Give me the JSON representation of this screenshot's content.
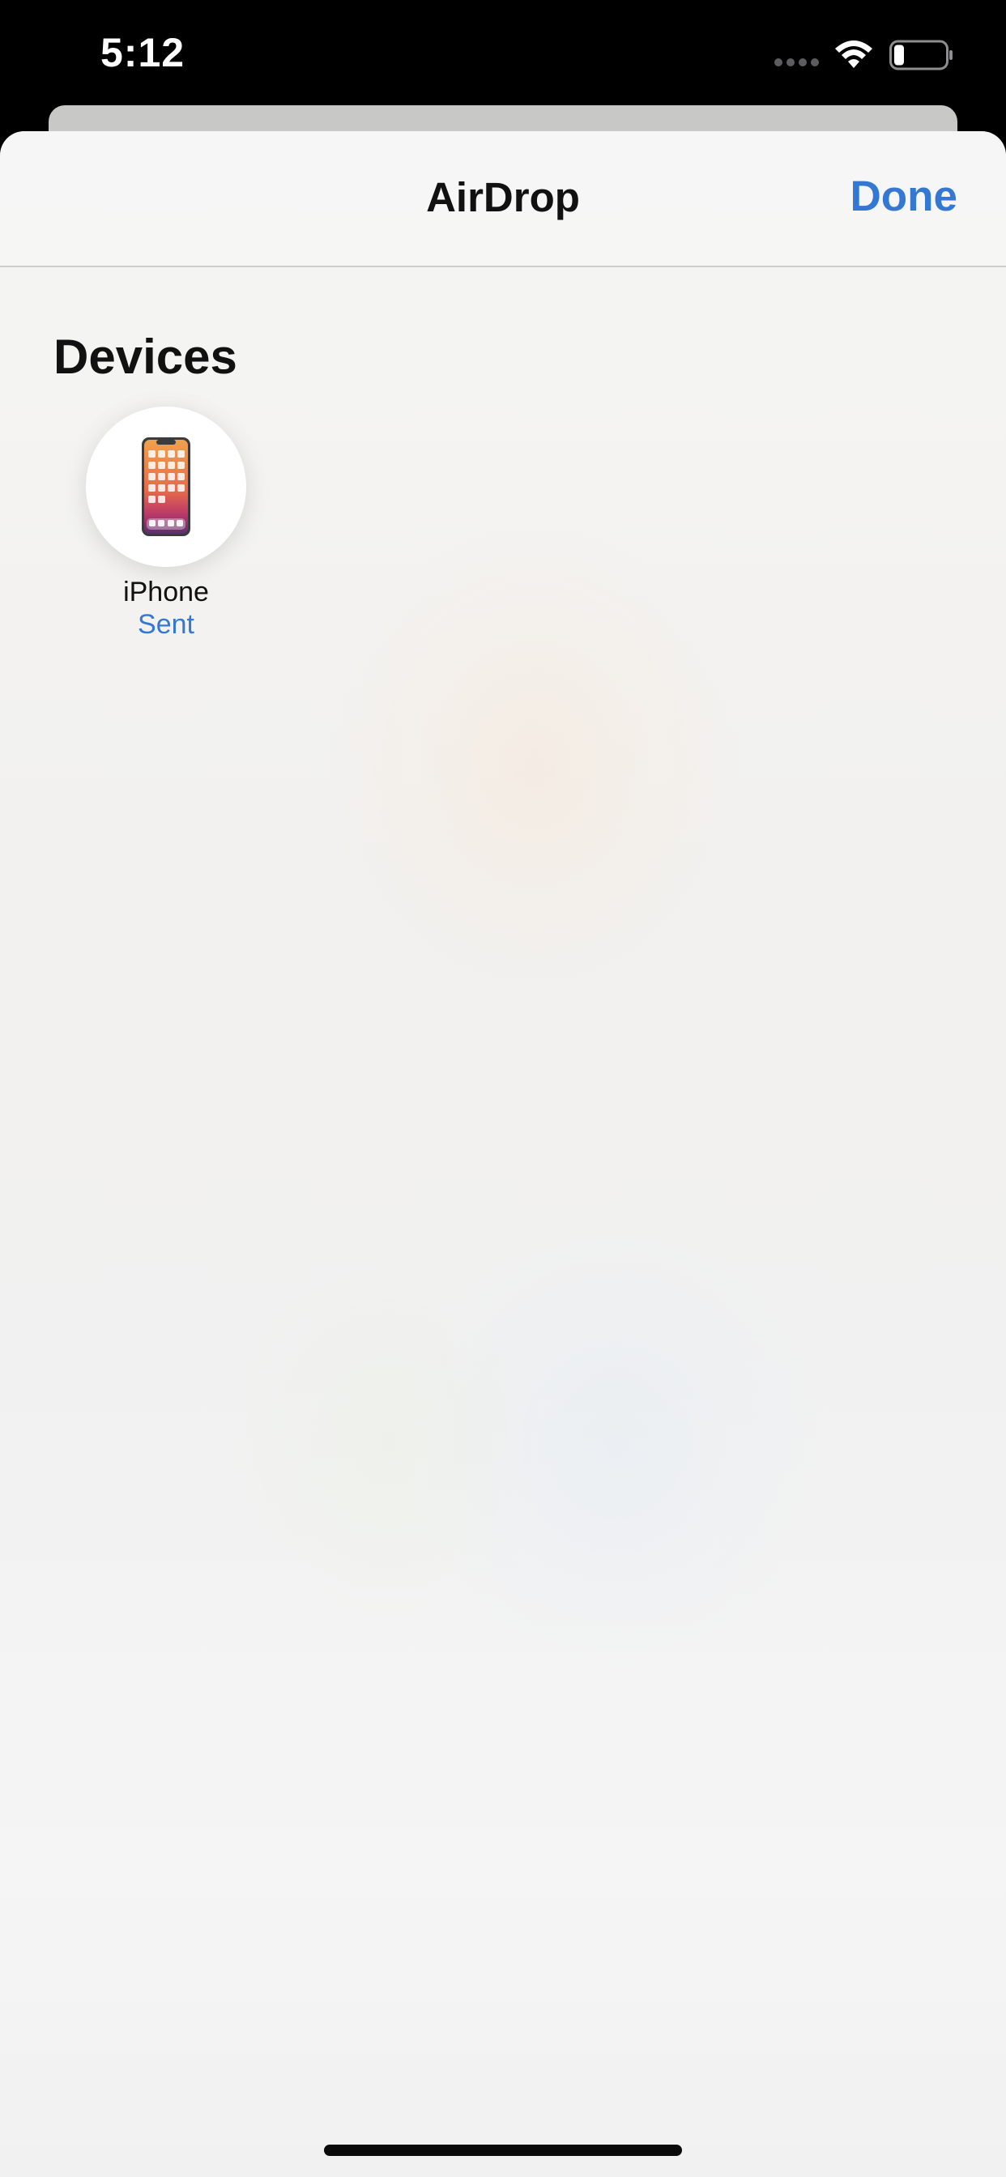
{
  "status_bar": {
    "time": "5:12",
    "icons": [
      "signal-dots-icon",
      "wifi-icon",
      "battery-icon"
    ],
    "battery_level": 0.2
  },
  "nav": {
    "title": "AirDrop",
    "done_label": "Done"
  },
  "devices_section": {
    "title": "Devices",
    "items": [
      {
        "name": "iPhone",
        "status": "Sent",
        "icon": "iphone-icon"
      }
    ]
  },
  "colors": {
    "accent": "#3478d4",
    "status_bar_bg": "#000000",
    "sheet_bg": "#f3f3f2"
  }
}
